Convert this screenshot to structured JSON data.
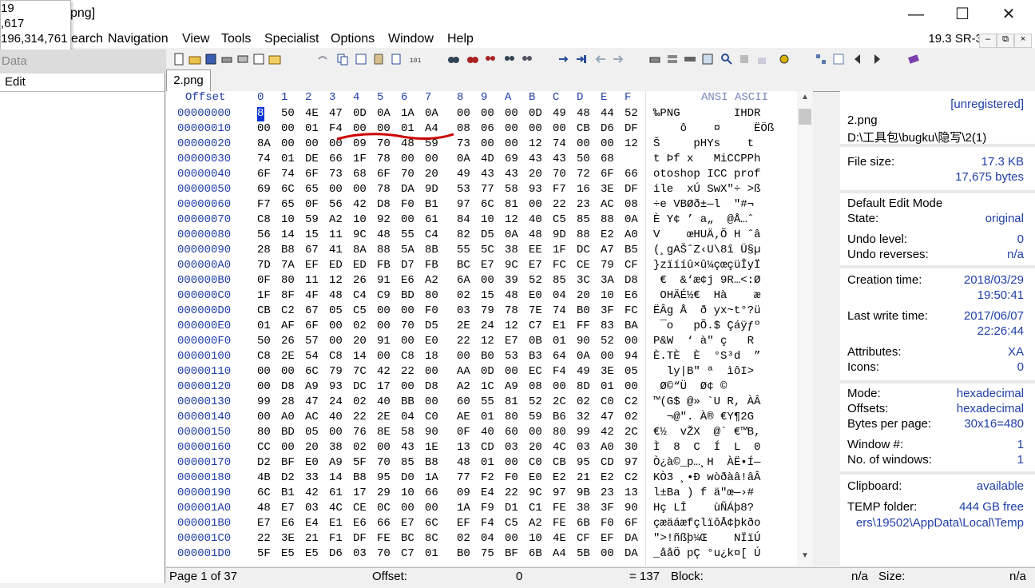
{
  "window": {
    "title": "png]",
    "minimize": "—",
    "maximize": "☐",
    "close": "✕"
  },
  "popup": {
    "lines": [
      "19",
      ",617",
      "196,314,761"
    ]
  },
  "menu": {
    "items": [
      "earch",
      "Navigation",
      "View",
      "Tools",
      "Specialist",
      "Options",
      "Window",
      "Help"
    ],
    "version": "19.3 SR-3",
    "mdi_min": "–",
    "mdi_restore": "⧉",
    "mdi_close": "×"
  },
  "leftpanel": {
    "header": "Data",
    "edit": "Edit"
  },
  "tab": {
    "label": "2.png"
  },
  "hex": {
    "offset_header": "Offset",
    "columns": [
      "0",
      "1",
      "2",
      "3",
      "4",
      "5",
      "6",
      "7",
      "8",
      "9",
      "A",
      "B",
      "C",
      "D",
      "E",
      "F"
    ],
    "ascii_header": "ANSI ASCII",
    "rows": [
      {
        "off": "00000000",
        "bytes": [
          "89",
          "50",
          "4E",
          "47",
          "0D",
          "0A",
          "1A",
          "0A",
          "00",
          "00",
          "00",
          "0D",
          "49",
          "48",
          "44",
          "52"
        ],
        "ascii": "‰PNG        IHDR"
      },
      {
        "off": "00000010",
        "bytes": [
          "00",
          "00",
          "01",
          "F4",
          "00",
          "00",
          "01",
          "A4",
          "08",
          "06",
          "00",
          "00",
          "00",
          "CB",
          "D6",
          "DF"
        ],
        "ascii": "    ô    ¤     ËÖß"
      },
      {
        "off": "00000020",
        "bytes": [
          "8A",
          "00",
          "00",
          "00",
          "09",
          "70",
          "48",
          "59",
          "73",
          "00",
          "00",
          "12",
          "74",
          "00",
          "00",
          "12"
        ],
        "ascii": "Š     pHYs    t"
      },
      {
        "off": "00000030",
        "bytes": [
          "74",
          "01",
          "DE",
          "66",
          "1F",
          "78",
          "00",
          "00",
          "0A",
          "4D",
          "69",
          "43",
          "43",
          "50",
          "68"
        ],
        "ascii": "t Þf x   MiCCPPh"
      },
      {
        "off": "00000040",
        "bytes": [
          "6F",
          "74",
          "6F",
          "73",
          "68",
          "6F",
          "70",
          "20",
          "49",
          "43",
          "43",
          "20",
          "70",
          "72",
          "6F",
          "66"
        ],
        "ascii": "otoshop ICC prof"
      },
      {
        "off": "00000050",
        "bytes": [
          "69",
          "6C",
          "65",
          "00",
          "00",
          "78",
          "DA",
          "9D",
          "53",
          "77",
          "58",
          "93",
          "F7",
          "16",
          "3E",
          "DF"
        ],
        "ascii": "ile  xÚ SwX\"÷ >ß"
      },
      {
        "off": "00000060",
        "bytes": [
          "F7",
          "65",
          "0F",
          "56",
          "42",
          "D8",
          "F0",
          "B1",
          "97",
          "6C",
          "81",
          "00",
          "22",
          "23",
          "AC",
          "08"
        ],
        "ascii": "÷e VBØð±—l  \"#¬"
      },
      {
        "off": "00000070",
        "bytes": [
          "C8",
          "10",
          "59",
          "A2",
          "10",
          "92",
          "00",
          "61",
          "84",
          "10",
          "12",
          "40",
          "C5",
          "85",
          "88",
          "0A"
        ],
        "ascii": "È Y¢ ’ a„  @Å…ˆ"
      },
      {
        "off": "00000080",
        "bytes": [
          "56",
          "14",
          "15",
          "11",
          "9C",
          "48",
          "55",
          "C4",
          "82",
          "D5",
          "0A",
          "48",
          "9D",
          "88",
          "E2",
          "A0"
        ],
        "ascii": "V    œHUÄ‚Õ H ˆâ"
      },
      {
        "off": "00000090",
        "bytes": [
          "28",
          "B8",
          "67",
          "41",
          "8A",
          "88",
          "5A",
          "8B",
          "55",
          "5C",
          "38",
          "EE",
          "1F",
          "DC",
          "A7",
          "B5"
        ],
        "ascii": "(¸gAŠˆZ‹U\\8î Ü§µ"
      },
      {
        "off": "000000A0",
        "bytes": [
          "7D",
          "7A",
          "EF",
          "ED",
          "ED",
          "FB",
          "D7",
          "FB",
          "BC",
          "E7",
          "9C",
          "E7",
          "FC",
          "CE",
          "79",
          "CF"
        ],
        "ascii": "}zïííû×û¼çœçüÎyÏ"
      },
      {
        "off": "000000B0",
        "bytes": [
          "0F",
          "80",
          "11",
          "12",
          "26",
          "91",
          "E6",
          "A2",
          "6A",
          "00",
          "39",
          "52",
          "85",
          "3C",
          "3A",
          "D8"
        ],
        "ascii": " €  &‘æ¢j 9R…<:Ø"
      },
      {
        "off": "000000C0",
        "bytes": [
          "1F",
          "8F",
          "4F",
          "48",
          "C4",
          "C9",
          "BD",
          "80",
          "02",
          "15",
          "48",
          "E0",
          "04",
          "20",
          "10",
          "E6"
        ],
        "ascii": " OHÄÉ½€  Hà    æ"
      },
      {
        "off": "000000D0",
        "bytes": [
          "CB",
          "C2",
          "67",
          "05",
          "C5",
          "00",
          "00",
          "F0",
          "03",
          "79",
          "78",
          "7E",
          "74",
          "B0",
          "3F",
          "FC"
        ],
        "ascii": "ËÂg Å  ð yx~t°?ü"
      },
      {
        "off": "000000E0",
        "bytes": [
          "01",
          "AF",
          "6F",
          "00",
          "02",
          "00",
          "70",
          "D5",
          "2E",
          "24",
          "12",
          "C7",
          "E1",
          "FF",
          "83",
          "BA"
        ],
        "ascii": " ¯o   pÕ.$ Çáÿƒº"
      },
      {
        "off": "000000F0",
        "bytes": [
          "50",
          "26",
          "57",
          "00",
          "20",
          "91",
          "00",
          "E0",
          "22",
          "12",
          "E7",
          "0B",
          "01",
          "90",
          "52",
          "00"
        ],
        "ascii": "P&W  ‘ à\" ç   R"
      },
      {
        "off": "00000100",
        "bytes": [
          "C8",
          "2E",
          "54",
          "C8",
          "14",
          "00",
          "C8",
          "18",
          "00",
          "B0",
          "53",
          "B3",
          "64",
          "0A",
          "00",
          "94"
        ],
        "ascii": "È.TÈ  È  °S³d  ”"
      },
      {
        "off": "00000110",
        "bytes": [
          "00",
          "00",
          "6C",
          "79",
          "7C",
          "42",
          "22",
          "00",
          "AA",
          "0D",
          "00",
          "EC",
          "F4",
          "49",
          "3E",
          "05"
        ],
        "ascii": "  ly|B\" ª  ìôI>"
      },
      {
        "off": "00000120",
        "bytes": [
          "00",
          "D8",
          "A9",
          "93",
          "DC",
          "17",
          "00",
          "D8",
          "A2",
          "1C",
          "A9",
          "08",
          "00",
          "8D",
          "01",
          "00"
        ],
        "ascii": " Ø©“Ü  Ø¢ ©"
      },
      {
        "off": "00000130",
        "bytes": [
          "99",
          "28",
          "47",
          "24",
          "02",
          "40",
          "BB",
          "00",
          "60",
          "55",
          "81",
          "52",
          "2C",
          "02",
          "C0",
          "C2"
        ],
        "ascii": "™(G$ @» `U R, ÀÂ"
      },
      {
        "off": "00000140",
        "bytes": [
          "00",
          "A0",
          "AC",
          "40",
          "22",
          "2E",
          "04",
          "C0",
          "AE",
          "01",
          "80",
          "59",
          "B6",
          "32",
          "47",
          "02"
        ],
        "ascii": "  ¬@\". À® €Y¶2G"
      },
      {
        "off": "00000150",
        "bytes": [
          "80",
          "BD",
          "05",
          "00",
          "76",
          "8E",
          "58",
          "90",
          "0F",
          "40",
          "60",
          "00",
          "80",
          "99",
          "42",
          "2C"
        ],
        "ascii": "€½  vŽX  @` €™B,"
      },
      {
        "off": "00000160",
        "bytes": [
          "CC",
          "00",
          "20",
          "38",
          "02",
          "00",
          "43",
          "1E",
          "13",
          "CD",
          "03",
          "20",
          "4C",
          "03",
          "A0",
          "30"
        ],
        "ascii": "Ì  8  C  Í  L  0"
      },
      {
        "off": "00000170",
        "bytes": [
          "D2",
          "BF",
          "E0",
          "A9",
          "5F",
          "70",
          "85",
          "B8",
          "48",
          "01",
          "00",
          "C0",
          "CB",
          "95",
          "CD",
          "97"
        ],
        "ascii": "Ò¿à©_p…¸H  ÀË•Í—"
      },
      {
        "off": "00000180",
        "bytes": [
          "4B",
          "D2",
          "33",
          "14",
          "B8",
          "95",
          "D0",
          "1A",
          "77",
          "F2",
          "F0",
          "E0",
          "E2",
          "21",
          "E2",
          "C2"
        ],
        "ascii": "KÒ3 ¸•Ð wòðàâ!âÂ"
      },
      {
        "off": "00000190",
        "bytes": [
          "6C",
          "B1",
          "42",
          "61",
          "17",
          "29",
          "10",
          "66",
          "09",
          "E4",
          "22",
          "9C",
          "97",
          "9B",
          "23",
          "13"
        ],
        "ascii": "l±Ba ) f ä\"œ—›#"
      },
      {
        "off": "000001A0",
        "bytes": [
          "48",
          "E7",
          "03",
          "4C",
          "CE",
          "0C",
          "00",
          "00",
          "1A",
          "F9",
          "D1",
          "C1",
          "FE",
          "38",
          "3F",
          "90"
        ],
        "ascii": "Hç LÎ    ùÑÁþ8?"
      },
      {
        "off": "000001B0",
        "bytes": [
          "E7",
          "E6",
          "E4",
          "E1",
          "E6",
          "66",
          "E7",
          "6C",
          "EF",
          "F4",
          "C5",
          "A2",
          "FE",
          "6B",
          "F0",
          "6F"
        ],
        "ascii": "çæäáæfçlïôÅ¢þkðo"
      },
      {
        "off": "000001C0",
        "bytes": [
          "22",
          "3E",
          "21",
          "F1",
          "DF",
          "FE",
          "BC",
          "8C",
          "02",
          "04",
          "00",
          "10",
          "4E",
          "CF",
          "EF",
          "DA"
        ],
        "ascii": "\">!ñßþ¼Œ    NÏïÚ"
      },
      {
        "off": "000001D0",
        "bytes": [
          "5F",
          "E5",
          "E5",
          "D6",
          "03",
          "70",
          "C7",
          "01",
          "B0",
          "75",
          "BF",
          "6B",
          "A4",
          "5B",
          "00",
          "DA"
        ],
        "ascii": "_ååÖ pÇ °u¿k¤[ Ú"
      }
    ]
  },
  "info": {
    "unregistered": "[unregistered]",
    "filename": "2.png",
    "path": "D:\\工具包\\bugku\\隐写\\2(1)",
    "file_size_label": "File size:",
    "file_size_kb": "17.3 KB",
    "file_size_bytes": "17,675 bytes",
    "edit_mode_label": "Default Edit Mode",
    "state_label": "State:",
    "state_value": "original",
    "undo_level_label": "Undo level:",
    "undo_level_value": "0",
    "undo_rev_label": "Undo reverses:",
    "undo_rev_value": "n/a",
    "ctime_label": "Creation time:",
    "ctime_date": "2018/03/29",
    "ctime_time": "19:50:41",
    "mtime_label": "Last write time:",
    "mtime_date": "2017/06/07",
    "mtime_time": "22:26:44",
    "attr_label": "Attributes:",
    "attr_value": "XA",
    "icons_label": "Icons:",
    "icons_value": "0",
    "mode_label": "Mode:",
    "mode_value": "hexadecimal",
    "offsets_label": "Offsets:",
    "offsets_value": "hexadecimal",
    "bpp_label": "Bytes per page:",
    "bpp_value": "30x16=480",
    "winnum_label": "Window #:",
    "winnum_value": "1",
    "nowin_label": "No. of windows:",
    "nowin_value": "1",
    "clip_label": "Clipboard:",
    "clip_value": "available",
    "temp_label": "TEMP folder:",
    "temp_value": "444 GB free",
    "temp_path": "ers\\19502\\AppData\\Local\\Temp"
  },
  "status": {
    "page": "Page 1 of 37",
    "offset_label": "Offset:",
    "offset_value": "0",
    "eq_value": "= 137",
    "block_label": "Block:",
    "block_value": "n/a",
    "size_label": "Size:",
    "size_value": "n/a"
  },
  "annotation_color": "#cc0000",
  "selection_color": "#0a35d8"
}
